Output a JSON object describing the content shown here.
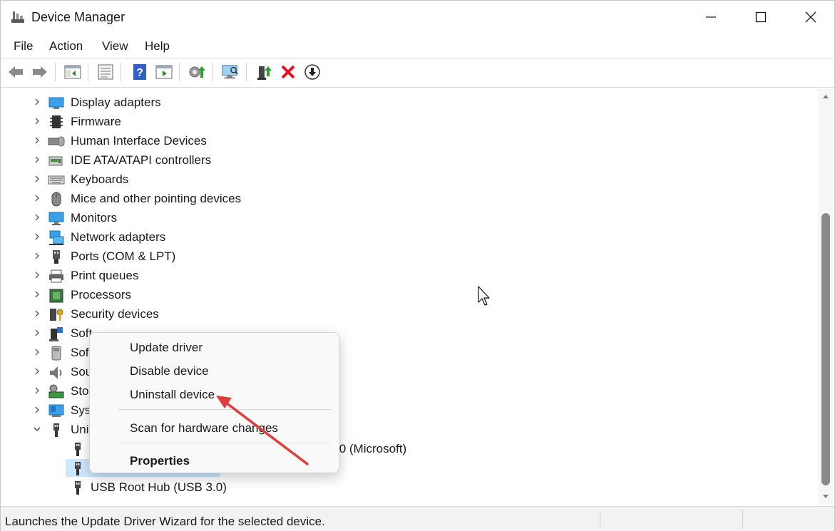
{
  "window": {
    "title": "Device Manager"
  },
  "menu": {
    "items": [
      "File",
      "Action",
      "View",
      "Help"
    ]
  },
  "toolbar": {
    "buttons": [
      "back-arrow-icon",
      "forward-arrow-icon",
      "show-hide-tree-icon",
      "properties-icon",
      "help-icon",
      "run-action-icon",
      "update-driver-icon",
      "scan-hardware-icon",
      "enable-device-icon",
      "uninstall-device-icon",
      "disable-device-icon"
    ]
  },
  "tree": {
    "categories": [
      {
        "label": "Display adapters"
      },
      {
        "label": "Firmware"
      },
      {
        "label": "Human Interface Devices"
      },
      {
        "label": "IDE ATA/ATAPI controllers"
      },
      {
        "label": "Keyboards"
      },
      {
        "label": "Mice and other pointing devices"
      },
      {
        "label": "Monitors"
      },
      {
        "label": "Network adapters"
      },
      {
        "label": "Ports (COM & LPT)"
      },
      {
        "label": "Print queues"
      },
      {
        "label": "Processors"
      },
      {
        "label": "Security devices"
      },
      {
        "label": "Soft"
      },
      {
        "label": "Sof"
      },
      {
        "label": "Sou"
      },
      {
        "label": "Sto"
      },
      {
        "label": "Sys"
      },
      {
        "label": "Uni"
      }
    ],
    "children": [
      {
        "label": ".0 (Microsoft)"
      },
      {
        "label": ""
      },
      {
        "label": "USB Root Hub (USB 3.0)"
      }
    ]
  },
  "context_menu": {
    "update_driver": "Update driver",
    "disable_device": "Disable device",
    "uninstall_device": "Uninstall device",
    "scan_changes": "Scan for hardware changes",
    "properties": "Properties"
  },
  "status": {
    "text": "Launches the Update Driver Wizard for the selected device."
  },
  "colors": {
    "selection": "#cce8ff",
    "annotation_arrow": "#e03c3c",
    "uninstall_red": "#e81123"
  }
}
